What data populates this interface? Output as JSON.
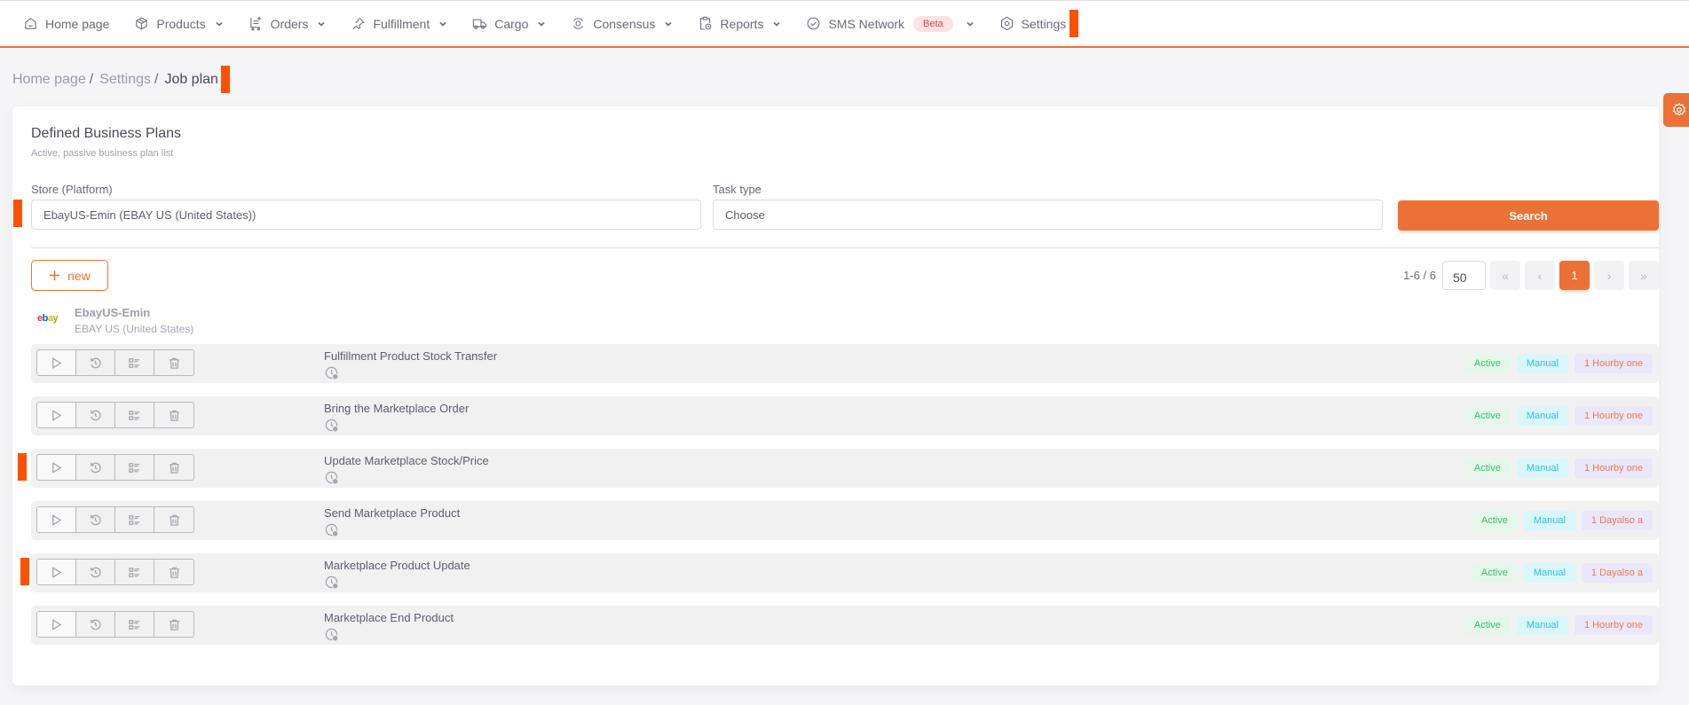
{
  "nav": {
    "items": [
      {
        "label": "Home page",
        "icon": "home-icon",
        "dropdown": false
      },
      {
        "label": "Products",
        "icon": "box-icon",
        "dropdown": true
      },
      {
        "label": "Orders",
        "icon": "cart-icon",
        "dropdown": true
      },
      {
        "label": "Fulfillment",
        "icon": "pin-icon",
        "dropdown": true
      },
      {
        "label": "Cargo",
        "icon": "truck-icon",
        "dropdown": true
      },
      {
        "label": "Consensus",
        "icon": "target-icon",
        "dropdown": true
      },
      {
        "label": "Reports",
        "icon": "clipboard-clock-icon",
        "dropdown": true
      },
      {
        "label": "SMS Network",
        "icon": "check-circle-icon",
        "dropdown": true,
        "badge": "Beta"
      },
      {
        "label": "Settings",
        "icon": "gear-hex-icon",
        "dropdown": false
      }
    ]
  },
  "breadcrumb": {
    "items": [
      "Home page",
      "Settings"
    ],
    "separator": "/",
    "current": "Job plan"
  },
  "card": {
    "title": "Defined Business Plans",
    "subtitle": "Active, passive business plan list"
  },
  "filters": {
    "store_label": "Store (Platform)",
    "store_value": "EbayUS-Emin (EBAY US (United States))",
    "task_label": "Task type",
    "task_placeholder": "Choose",
    "search_label": "Search"
  },
  "toolbar": {
    "new_label": "new"
  },
  "pagination": {
    "range": "1-6 / 6",
    "page_size": "50",
    "first": "«",
    "prev": "‹",
    "current_page": "1",
    "next": "›",
    "last": "»"
  },
  "store": {
    "logo": {
      "e": "e",
      "b": "b",
      "a": "a",
      "y": "y"
    },
    "name": "EbayUS-Emin",
    "platform": "EBAY US (United States)"
  },
  "colors": {
    "accent": "#ec7136",
    "marker": "#fb5200",
    "active": "#3dbd6e",
    "manual": "#2bc3de",
    "frequency": "#ef7a4f"
  },
  "jobs": [
    {
      "title": "Fulfillment Product Stock Transfer",
      "status": "Active",
      "mode": "Manual",
      "frequency": "1 Hourby one"
    },
    {
      "title": "Bring the Marketplace Order",
      "status": "Active",
      "mode": "Manual",
      "frequency": "1 Hourby one"
    },
    {
      "title": "Update Marketplace Stock/Price",
      "status": "Active",
      "mode": "Manual",
      "frequency": "1 Hourby one"
    },
    {
      "title": "Send Marketplace Product",
      "status": "Active",
      "mode": "Manual",
      "frequency": "1 Dayalso a"
    },
    {
      "title": "Marketplace Product Update",
      "status": "Active",
      "mode": "Manual",
      "frequency": "1 Dayalso a"
    },
    {
      "title": "Marketplace End Product",
      "status": "Active",
      "mode": "Manual",
      "frequency": "1 Hourby one"
    }
  ]
}
